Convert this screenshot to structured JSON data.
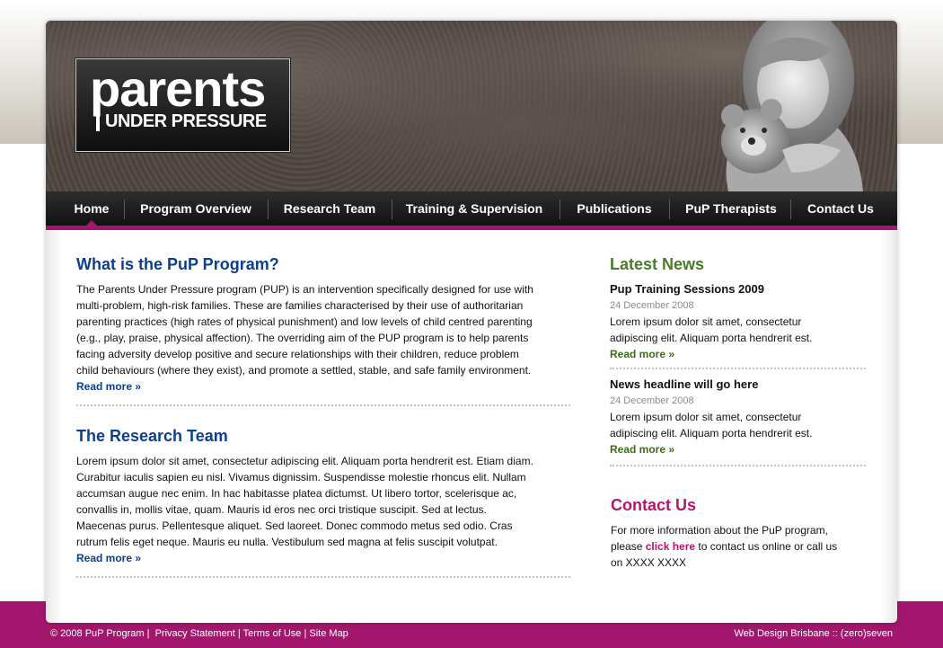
{
  "logo": {
    "parents": "parents",
    "under_pressure": "UNDER PRESSURE"
  },
  "nav": {
    "items": [
      "Home",
      "Program Overview",
      "Research Team",
      "Training & Supervision",
      "Publications",
      "PuP Therapists",
      "Contact Us"
    ]
  },
  "main": {
    "section1": {
      "title": "What is the PuP Program?",
      "lines": [
        "The Parents Under Pressure program (PUP) is an intervention specifically designed for use with",
        "multi-problem, high-risk families. These are families characterised by their use of authoritarian",
        "parenting practices (high rates of physical punishment) and low levels of child centred parenting",
        "(e.g., play, praise, physical affection). The overriding aim of the PUP program is to help parents",
        "facing adversity develop positive and secure relationships with their children, reduce problem",
        "child behaviours (where they exist), and promote a settled, stable, and safe family environment."
      ],
      "read_more": "Read more »"
    },
    "section2": {
      "title": "The Research Team",
      "lines": [
        "Lorem ipsum dolor sit amet, consectetur adipiscing elit. Aliquam porta hendrerit est. Etiam diam.",
        "Curabitur iaculis sapien eu nisl. Vivamus dignissim. Suspendisse molestie rhoncus elit. Nullam",
        "accumsan augue nec enim. In hac habitasse platea dictumst. Ut libero tortor, scelerisque ac,",
        "convallis in, mollis vitae, quam. Mauris id eros nec orci tristique suscipit. Sed at lectus.",
        "Maecenas purus. Pellentesque aliquet. Sed laoreet. Donec commodo metus sed odio. Cras",
        "rutrum felis eget neque. Mauris eu nulla. Vestibulum sed magna at felis suscipit volutpat."
      ],
      "read_more": "Read more »"
    }
  },
  "sidebar": {
    "news_title": "Latest News",
    "news": [
      {
        "headline": "Pup Training Sessions 2009",
        "date": "24 December 2008",
        "lines": [
          "Lorem ipsum dolor sit amet, consectetur",
          "adipiscing elit. Aliquam porta hendrerit est."
        ],
        "read_more": "Read more »"
      },
      {
        "headline": "News headline will go here",
        "date": "24 December 2008",
        "lines": [
          "Lorem ipsum dolor sit amet, consectetur",
          "adipiscing elit. Aliquam porta hendrerit est."
        ],
        "read_more": "Read more »"
      }
    ],
    "contact": {
      "title": "Contact Us",
      "line1": "For more information about the PuP program,",
      "line2_pre": "please ",
      "line2_link": "click here",
      "line2_post": " to contact us online or call us",
      "line3": "on XXXX XXXX"
    }
  },
  "footer": {
    "copyright": "© 2008 PuP Program |",
    "links": [
      "Privacy Statement",
      "Terms of Use",
      "Site Map"
    ],
    "separator": "|",
    "credit": "Web Design Brisbane :: (zero)seven"
  },
  "colors": {
    "accent_pink": "#a3166e",
    "heading_blue": "#0b3f8f",
    "heading_green": "#4a7b2a"
  }
}
